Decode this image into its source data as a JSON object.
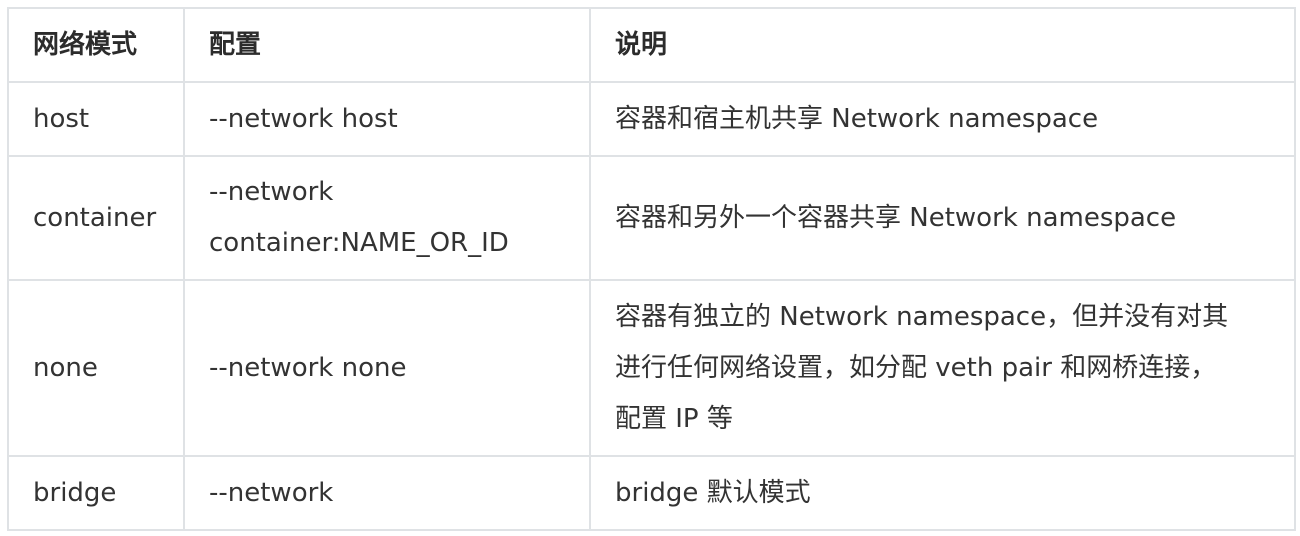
{
  "table": {
    "headers": [
      "网络模式",
      "配置",
      "说明"
    ],
    "rows": [
      {
        "mode": "host",
        "config": [
          "--network host"
        ],
        "description": [
          "容器和宿主机共享 Network namespace"
        ]
      },
      {
        "mode": "container",
        "config": [
          "--network",
          "container:NAME_OR_ID"
        ],
        "description": [
          "容器和另外一个容器共享 Network namespace"
        ]
      },
      {
        "mode": "none",
        "config": [
          "--network none"
        ],
        "description": [
          "容器有独立的 Network namespace，但并没有对其",
          "进行任何网络设置，如分配 veth pair 和网桥连接，",
          "配置 IP 等"
        ]
      },
      {
        "mode": "bridge",
        "config": [
          "--network"
        ],
        "description": [
          "bridge 默认模式"
        ]
      }
    ]
  }
}
